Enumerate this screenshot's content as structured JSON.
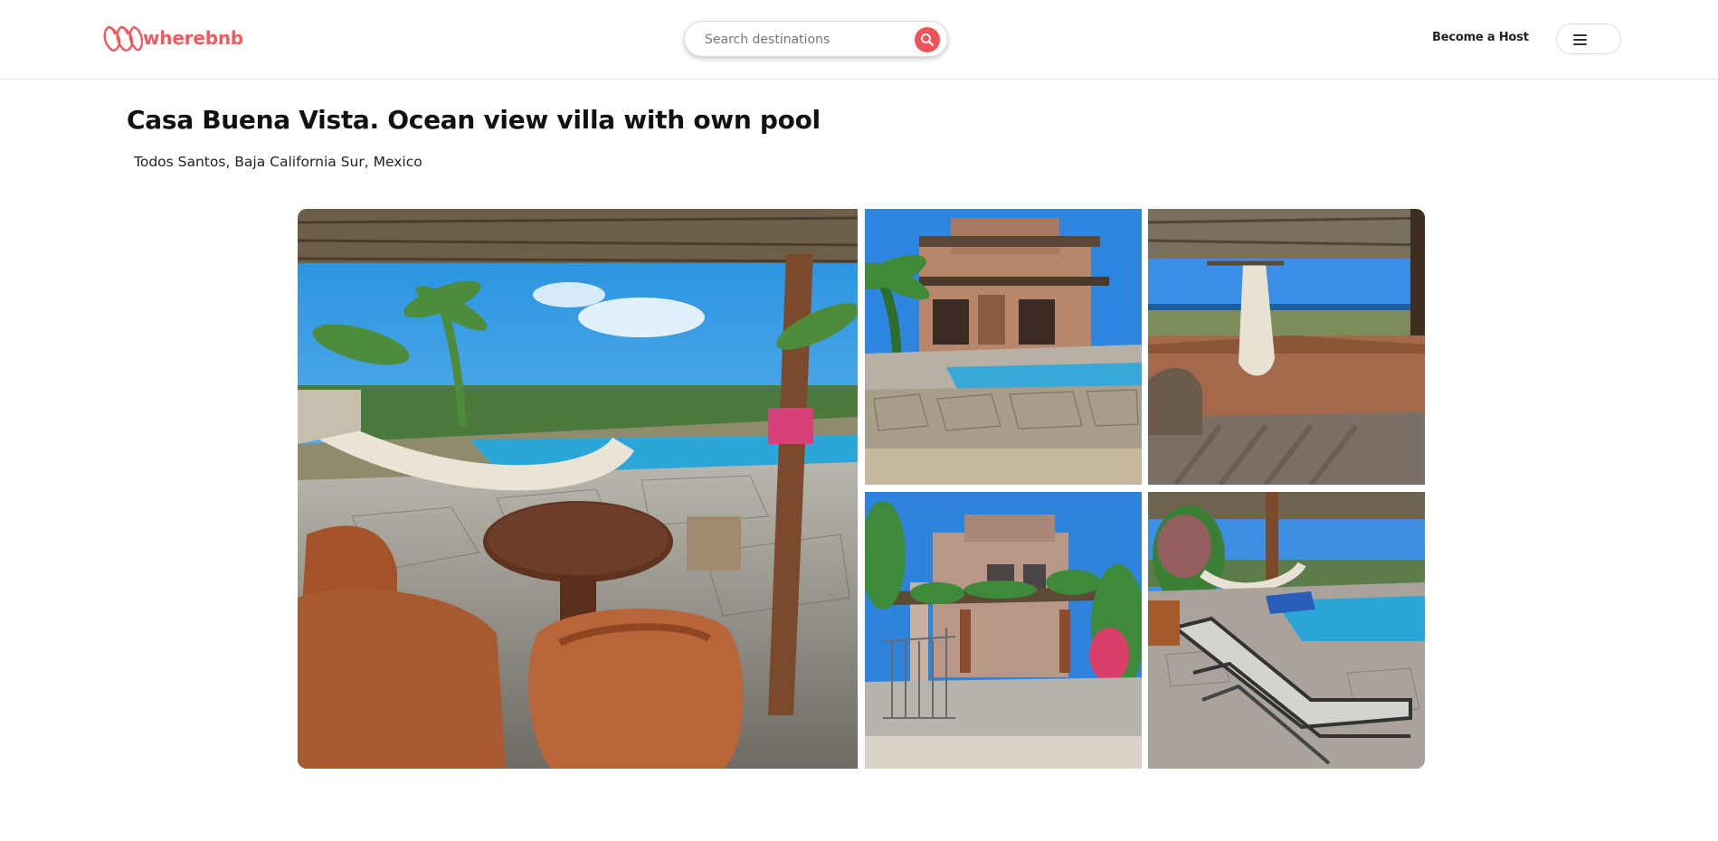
{
  "header": {
    "logo_text": "wherebnb",
    "search": {
      "placeholder": "Search destinations",
      "icon": "search-icon"
    },
    "become_host_label": "Become a Host",
    "menu_icon": "hamburger-icon"
  },
  "listing": {
    "title": "Casa Buena Vista. Ocean view villa with own pool",
    "location": "Todos Santos, Baja California Sur, Mexico"
  },
  "gallery": {
    "photos": [
      {
        "name": "pool-patio-hammock-photo"
      },
      {
        "name": "villa-exterior-pool-photo"
      },
      {
        "name": "terrace-hammock-ocean-view-photo"
      },
      {
        "name": "villa-entrance-gate-photo"
      },
      {
        "name": "pool-lounge-chairs-photo"
      }
    ]
  },
  "colors": {
    "brand": "#f25a62",
    "search_button": "#f0525a"
  }
}
